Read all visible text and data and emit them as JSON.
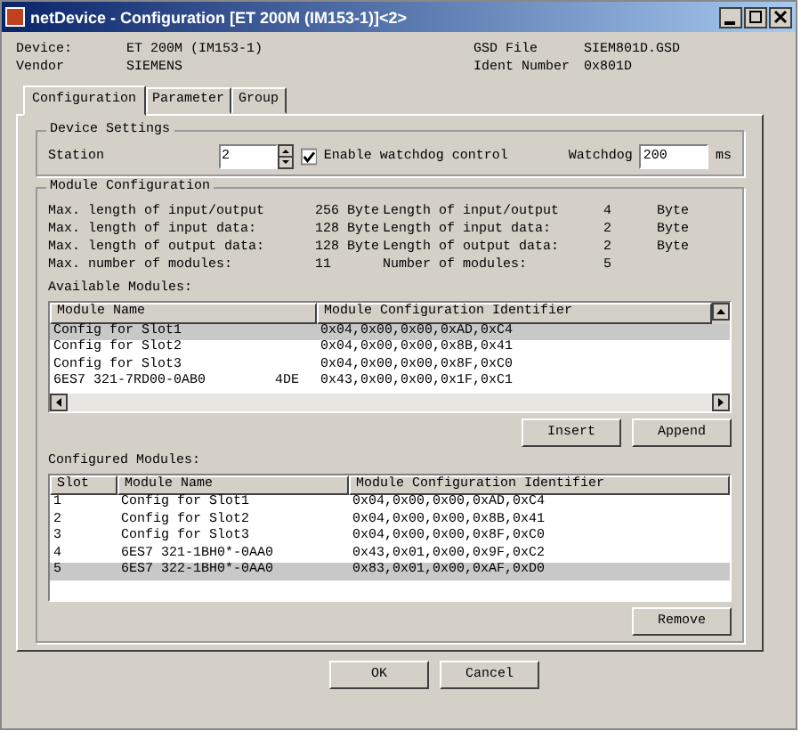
{
  "window": {
    "title": "netDevice - Configuration [ET 200M (IM153-1)]<2>"
  },
  "device_info": [
    {
      "label": "Device:",
      "value": "ET 200M (IM153-1)"
    },
    {
      "label": "GSD File",
      "value": "SIEM801D.GSD"
    },
    {
      "label": "Vendor",
      "value": "SIEMENS"
    },
    {
      "label": "Ident Number",
      "value": "0x801D"
    }
  ],
  "tabs": [
    {
      "label": "Configuration",
      "selected": true
    },
    {
      "label": "Parameter",
      "selected": false
    },
    {
      "label": "Group",
      "selected": false
    }
  ],
  "device_settings": {
    "title": "Device Settings",
    "station_label": "Station",
    "station_value": "2",
    "watchdog_checkbox": {
      "label": "Enable watchdog control",
      "checked": true
    },
    "watchdog_label": "Watchdog",
    "watchdog_value": "200",
    "unit": "ms"
  },
  "module_configuration": {
    "title": "Module Configuration",
    "rows": [
      {
        "label": "Max. length of input/output",
        "value": "256 Byte",
        "label_2": "Length of input/output",
        "value_2": "4",
        "unit": "Byte"
      },
      {
        "label": "Max. length of input data:",
        "value": "128 Byte",
        "label_2": "Length of input data:",
        "value_2": "2",
        "unit": "Byte"
      },
      {
        "label": "Max. length of output data:",
        "value": "128 Byte",
        "label_2": "Length of output data:",
        "value_2": "2",
        "unit": "Byte"
      },
      {
        "label": "Max. number of modules:",
        "value": "11",
        "label_2": "Number of modules:",
        "value_2": "5",
        "unit": ""
      }
    ]
  },
  "available_modules": {
    "title": "Available Modules:",
    "columns": [
      "Module Name",
      "Module Configuration Identifier"
    ],
    "rows": [
      {
        "name": "Config for Slot1",
        "extra": "",
        "identifier": "0x04,0x00,0x00,0xAD,0xC4",
        "selected": true
      },
      {
        "name": "Config for Slot2",
        "extra": "",
        "identifier": "0x04,0x00,0x00,0x8B,0x41",
        "selected": false
      },
      {
        "name": "Config for Slot3",
        "extra": "",
        "identifier": "0x04,0x00,0x00,0x8F,0xC0",
        "selected": false
      },
      {
        "name": "6ES7 321-7RD00-0AB0",
        "extra": "4DE",
        "identifier": "0x43,0x00,0x00,0x1F,0xC1",
        "selected": false
      }
    ],
    "buttons": [
      "Insert",
      "Append"
    ]
  },
  "configured_modules": {
    "title": "Configured Modules:",
    "columns": [
      "Slot",
      "Module Name",
      "Module Configuration Identifier"
    ],
    "rows": [
      {
        "slot": "1",
        "name": "Config for Slot1",
        "identifier": "0x04,0x00,0x00,0xAD,0xC4",
        "selected": false
      },
      {
        "slot": "2",
        "name": "Config for Slot2",
        "identifier": "0x04,0x00,0x00,0x8B,0x41",
        "selected": false
      },
      {
        "slot": "3",
        "name": "Config for Slot3",
        "identifier": "0x04,0x00,0x00,0x8F,0xC0",
        "selected": false
      },
      {
        "slot": "4",
        "name": "6ES7 321-1BH0*-0AA0",
        "identifier": "0x43,0x01,0x00,0x9F,0xC2",
        "selected": false
      },
      {
        "slot": "5",
        "name": "6ES7 322-1BH0*-0AA0",
        "identifier": "0x83,0x01,0x00,0xAF,0xD0",
        "selected": true
      }
    ],
    "buttons": [
      "Remove"
    ]
  },
  "footer_buttons": [
    "OK",
    "Cancel"
  ]
}
